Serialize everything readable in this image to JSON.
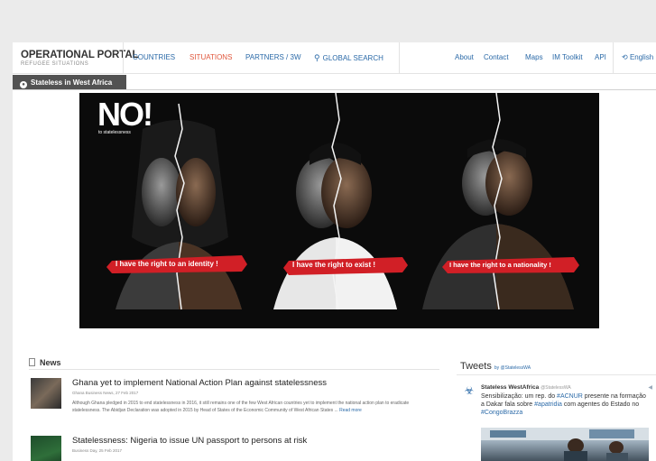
{
  "header": {
    "brand_title": "OPERATIONAL PORTAL",
    "brand_sub": "REFUGEE SITUATIONS",
    "nav": {
      "countries": "COUNTRIES",
      "situations": "SITUATIONS",
      "partners": "PARTNERS / 3W",
      "global_search": "GLOBAL SEARCH"
    },
    "links": {
      "about": "About",
      "contact": "Contact",
      "maps": "Maps",
      "im_toolkit": "IM Toolkit",
      "api": "API",
      "language": "English"
    },
    "active_color": "#e0563b",
    "link_color": "#2b6aa8"
  },
  "breadcrumb": {
    "label": "Stateless in West Africa"
  },
  "banner": {
    "logo": "NO!",
    "logo_sub": "to statelessness",
    "ribbons": [
      "I have the right to an identity !",
      "I have the right to exist !",
      "I have the right to a nationality !"
    ],
    "ribbon_color": "#d11f26"
  },
  "news": {
    "heading": "News",
    "articles": [
      {
        "title": "Ghana yet to implement National Action Plan against statelessness",
        "meta": "Ghana Business News, 27 Feb 2017",
        "body": "Although Ghana pledged in 2015 to end statelessness in 2016, it still remains one of the few West African countries yet to implement the national action plan to eradicate statelessness. The Abidjan Declaration was adopted in 2015 by Head of States of the Economic Community of West African States ...",
        "read_more": "Read more"
      },
      {
        "title": "Statelessness: Nigeria to issue UN passport to persons at risk",
        "meta": "Business Day, 25 Feb 2017"
      }
    ]
  },
  "tweets": {
    "heading": "Tweets",
    "by": "by @StatelessWA",
    "name": "Stateless WestAfrica",
    "handle": "@StatelessWA",
    "text_a": "Sensibilização: um rep. do ",
    "tag1": "#ACNUR",
    "text_b": " presente na formação a Dakar fala sobre ",
    "tag2": "#apatridia",
    "text_c": " com agentes do Estado no ",
    "tag3": "#CongoBrazza"
  }
}
